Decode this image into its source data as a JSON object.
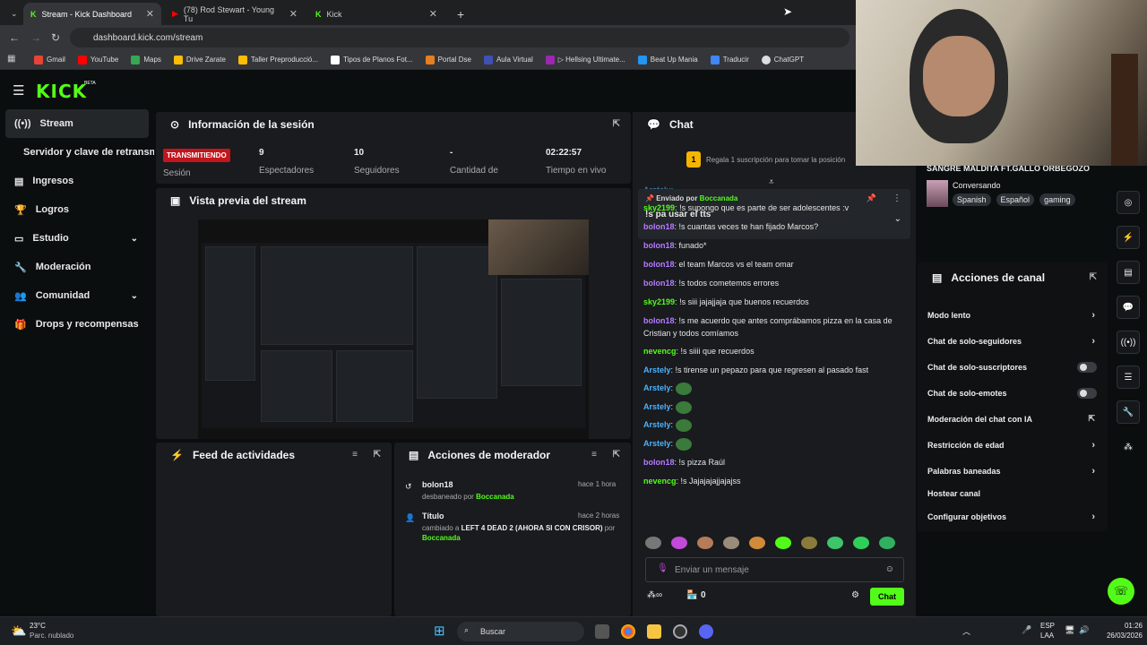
{
  "browser": {
    "tabs": [
      {
        "title": "Stream - Kick Dashboard"
      },
      {
        "title": "(78) Rod Stewart - Young Tu"
      },
      {
        "title": "Kick"
      }
    ],
    "url": "dashboard.kick.com/stream",
    "bookmarks": [
      "Gmail",
      "YouTube",
      "Maps",
      "Drive Zarate",
      "Taller Preproducció...",
      "Tipos de Planos Fot...",
      "Portal Dse",
      "Aula Virtual",
      "▷ Hellsing Ultimate...",
      "Beat Up Mania",
      "Traducir",
      "ChatGPT"
    ]
  },
  "kick": {
    "logo": "KICK",
    "beta": "BETA",
    "sidebar": [
      {
        "label": "Stream"
      },
      {
        "label": "Servidor y clave de retransmisión"
      },
      {
        "label": "Ingresos"
      },
      {
        "label": "Logros"
      },
      {
        "label": "Estudio"
      },
      {
        "label": "Moderación"
      },
      {
        "label": "Comunidad"
      },
      {
        "label": "Drops y recompensas"
      }
    ],
    "session": {
      "title": "Información de la sesión",
      "live_badge": "TRANSMITIENDO",
      "session_label": "Sesión",
      "viewers_value": "9",
      "viewers_label": "Espectadores",
      "followers_value": "10",
      "followers_label": "Seguidores",
      "amount_value": "-",
      "amount_label": "Cantidad de",
      "time_value": "02:22:57",
      "time_label": "Tiempo en vivo"
    },
    "preview": {
      "title": "Vista previa del stream"
    },
    "feed": {
      "title": "Feed de actividades"
    },
    "mod_actions": {
      "title": "Acciones de moderador",
      "entries": [
        {
          "name": "bolon18",
          "time": "hace 1 hora",
          "line1": "desbaneado por",
          "by": "Boccanada"
        },
        {
          "name": "Título",
          "time": "hace 2 horas",
          "line1": "cambiado a",
          "value": "LEFT 4 DEAD 2 (AHORA SI CON CRISOR)",
          "line2": "por",
          "by": "Boccanada"
        }
      ]
    },
    "chat": {
      "title": "Chat",
      "gift_banner": "Regala 1 suscripción para tomar la posición",
      "gift_rank": "1",
      "partial_user": "Arstely:",
      "pinned_label": "Enviado por",
      "pinned_by": "Boccanada",
      "pinned_text": "!s pa usar el tts",
      "messages": [
        {
          "user": "sky2199",
          "text": "!s supongo que es parte de ser adolescentes :v"
        },
        {
          "user": "bolon18",
          "text": "!s cuantas veces te han fijado Marcos?"
        },
        {
          "user": "bolon18",
          "text": "funado*"
        },
        {
          "user": "bolon18",
          "text": "el team Marcos vs el team omar"
        },
        {
          "user": "bolon18",
          "text": "!s todos cometemos errores"
        },
        {
          "user": "sky2199",
          "text": "!s siii jajajjaja que buenos recuerdos"
        },
        {
          "user": "bolon18",
          "text": "!s me acuerdo que antes comprábamos pizza en la casa de Cristian y todos comíamos"
        },
        {
          "user": "nevencg",
          "text": "!s siiii que recuerdos"
        },
        {
          "user": "Arstely",
          "text": "!s tirense un pepazo para que regresen al pasado fast"
        },
        {
          "user": "Arstely",
          "text": ""
        },
        {
          "user": "Arstely",
          "text": ""
        },
        {
          "user": "Arstely",
          "text": ""
        },
        {
          "user": "Arstely",
          "text": ""
        },
        {
          "user": "bolon18",
          "text": "!s pizza Raúl"
        },
        {
          "user": "nevencg",
          "text": "!s Jajajajajjajajss"
        }
      ],
      "input_placeholder": "Enviar un mensaje",
      "points": "0",
      "send_label": "Chat"
    },
    "stream_info": {
      "title": "SANGRE MALDITA FT.GALLO ORBEGOZO",
      "category": "Conversando",
      "tags": [
        "Spanish",
        "Español",
        "gaming"
      ]
    },
    "channel_actions": {
      "title": "Acciones de canal",
      "items": [
        {
          "label": "Modo lento"
        },
        {
          "label": "Chat de solo-seguidores"
        },
        {
          "label": "Chat de solo-suscriptores"
        },
        {
          "label": "Chat de solo-emotes"
        },
        {
          "label": "Moderación del chat con IA"
        },
        {
          "label": "Restricción de edad"
        },
        {
          "label": "Palabras baneadas"
        },
        {
          "label": "Hostear canal"
        },
        {
          "label": "Configurar objetivos"
        }
      ]
    }
  },
  "taskbar": {
    "weather_temp": "23°C",
    "weather_desc": "Parc. nublado",
    "search": "Buscar",
    "lang1": "ESP",
    "lang2": "LAA",
    "time": "01:26",
    "date": "26/03/2026"
  },
  "colors": {
    "accent": "#53fc18",
    "live": "#c4151c",
    "bg": "#0b0e0f",
    "panel": "#191b1f"
  }
}
